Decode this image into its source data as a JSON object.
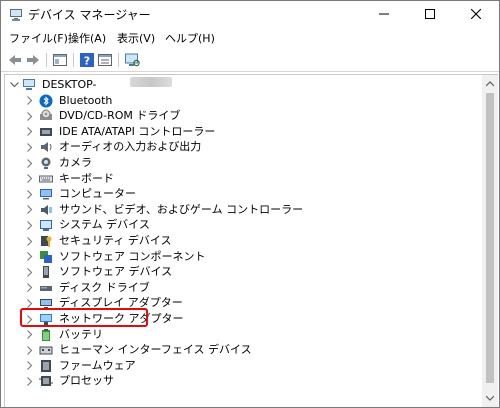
{
  "window": {
    "title": "デバイス マネージャー",
    "icons": {
      "app": "device-manager-icon",
      "minimize": "minimize-icon",
      "maximize": "maximize-icon",
      "close": "close-icon"
    }
  },
  "menu": [
    {
      "label": "ファイル(F)"
    },
    {
      "label": "操作(A)"
    },
    {
      "label": "表示(V)"
    },
    {
      "label": "ヘルプ(H)"
    }
  ],
  "toolbar": [
    "back-arrow-icon",
    "forward-arrow-icon",
    "properties-pane-icon",
    "help-icon",
    "view-icon",
    "scan-hardware-icon"
  ],
  "tree": {
    "root": {
      "label": "DESKTOP-",
      "icon": "computer-icon",
      "expanded": true
    },
    "items": [
      {
        "label": "Bluetooth",
        "icon": "bluetooth-icon"
      },
      {
        "label": "DVD/CD-ROM ドライブ",
        "icon": "dvd-drive-icon"
      },
      {
        "label": "IDE ATA/ATAPI コントローラー",
        "icon": "ide-controller-icon"
      },
      {
        "label": "オーディオの入力および出力",
        "icon": "speaker-icon"
      },
      {
        "label": "カメラ",
        "icon": "camera-icon"
      },
      {
        "label": "キーボード",
        "icon": "keyboard-icon"
      },
      {
        "label": "コンピューター",
        "icon": "monitor-icon"
      },
      {
        "label": "サウンド、ビデオ、およびゲーム コントローラー",
        "icon": "sound-controller-icon"
      },
      {
        "label": "システム デバイス",
        "icon": "system-devices-icon"
      },
      {
        "label": "セキュリティ デバイス",
        "icon": "security-key-icon"
      },
      {
        "label": "ソフトウェア コンポーネント",
        "icon": "software-component-icon"
      },
      {
        "label": "ソフトウェア デバイス",
        "icon": "software-device-icon"
      },
      {
        "label": "ディスク ドライブ",
        "icon": "disk-drive-icon"
      },
      {
        "label": "ディスプレイ アダプター",
        "icon": "display-adapter-icon"
      },
      {
        "label": "ネットワーク アダプター",
        "icon": "network-adapter-icon",
        "highlighted": true
      },
      {
        "label": "バッテリ",
        "icon": "battery-icon"
      },
      {
        "label": "ヒューマン インターフェイス デバイス",
        "icon": "hid-icon"
      },
      {
        "label": "ファームウェア",
        "icon": "firmware-icon"
      },
      {
        "label": "プロセッサ",
        "icon": "processor-icon"
      }
    ]
  },
  "colors": {
    "highlight_box": "#e20a0a",
    "selected_accent": "#0078d7"
  }
}
